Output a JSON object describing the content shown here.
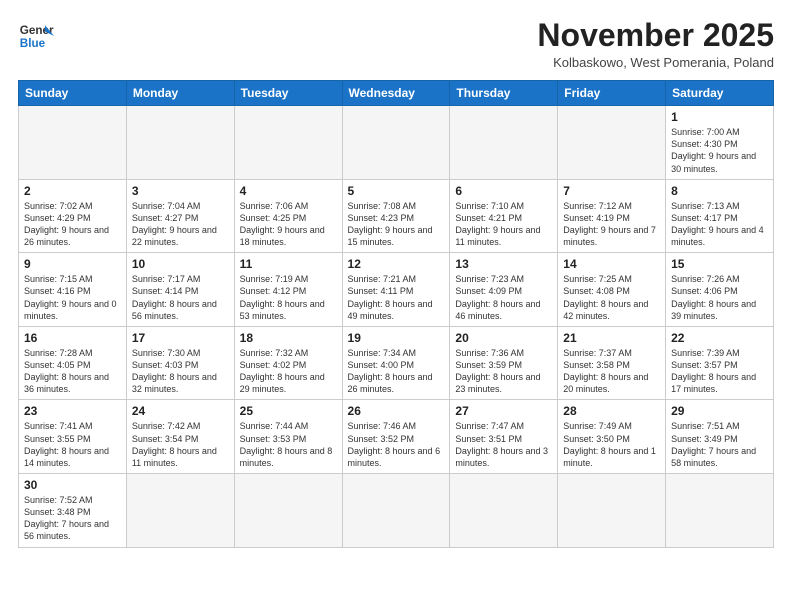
{
  "header": {
    "logo_general": "General",
    "logo_blue": "Blue",
    "month_title": "November 2025",
    "subtitle": "Kolbaskowo, West Pomerania, Poland"
  },
  "days_of_week": [
    "Sunday",
    "Monday",
    "Tuesday",
    "Wednesday",
    "Thursday",
    "Friday",
    "Saturday"
  ],
  "weeks": [
    [
      {
        "num": "",
        "info": ""
      },
      {
        "num": "",
        "info": ""
      },
      {
        "num": "",
        "info": ""
      },
      {
        "num": "",
        "info": ""
      },
      {
        "num": "",
        "info": ""
      },
      {
        "num": "",
        "info": ""
      },
      {
        "num": "1",
        "info": "Sunrise: 7:00 AM\nSunset: 4:30 PM\nDaylight: 9 hours and 30 minutes."
      }
    ],
    [
      {
        "num": "2",
        "info": "Sunrise: 7:02 AM\nSunset: 4:29 PM\nDaylight: 9 hours and 26 minutes."
      },
      {
        "num": "3",
        "info": "Sunrise: 7:04 AM\nSunset: 4:27 PM\nDaylight: 9 hours and 22 minutes."
      },
      {
        "num": "4",
        "info": "Sunrise: 7:06 AM\nSunset: 4:25 PM\nDaylight: 9 hours and 18 minutes."
      },
      {
        "num": "5",
        "info": "Sunrise: 7:08 AM\nSunset: 4:23 PM\nDaylight: 9 hours and 15 minutes."
      },
      {
        "num": "6",
        "info": "Sunrise: 7:10 AM\nSunset: 4:21 PM\nDaylight: 9 hours and 11 minutes."
      },
      {
        "num": "7",
        "info": "Sunrise: 7:12 AM\nSunset: 4:19 PM\nDaylight: 9 hours and 7 minutes."
      },
      {
        "num": "8",
        "info": "Sunrise: 7:13 AM\nSunset: 4:17 PM\nDaylight: 9 hours and 4 minutes."
      }
    ],
    [
      {
        "num": "9",
        "info": "Sunrise: 7:15 AM\nSunset: 4:16 PM\nDaylight: 9 hours and 0 minutes."
      },
      {
        "num": "10",
        "info": "Sunrise: 7:17 AM\nSunset: 4:14 PM\nDaylight: 8 hours and 56 minutes."
      },
      {
        "num": "11",
        "info": "Sunrise: 7:19 AM\nSunset: 4:12 PM\nDaylight: 8 hours and 53 minutes."
      },
      {
        "num": "12",
        "info": "Sunrise: 7:21 AM\nSunset: 4:11 PM\nDaylight: 8 hours and 49 minutes."
      },
      {
        "num": "13",
        "info": "Sunrise: 7:23 AM\nSunset: 4:09 PM\nDaylight: 8 hours and 46 minutes."
      },
      {
        "num": "14",
        "info": "Sunrise: 7:25 AM\nSunset: 4:08 PM\nDaylight: 8 hours and 42 minutes."
      },
      {
        "num": "15",
        "info": "Sunrise: 7:26 AM\nSunset: 4:06 PM\nDaylight: 8 hours and 39 minutes."
      }
    ],
    [
      {
        "num": "16",
        "info": "Sunrise: 7:28 AM\nSunset: 4:05 PM\nDaylight: 8 hours and 36 minutes."
      },
      {
        "num": "17",
        "info": "Sunrise: 7:30 AM\nSunset: 4:03 PM\nDaylight: 8 hours and 32 minutes."
      },
      {
        "num": "18",
        "info": "Sunrise: 7:32 AM\nSunset: 4:02 PM\nDaylight: 8 hours and 29 minutes."
      },
      {
        "num": "19",
        "info": "Sunrise: 7:34 AM\nSunset: 4:00 PM\nDaylight: 8 hours and 26 minutes."
      },
      {
        "num": "20",
        "info": "Sunrise: 7:36 AM\nSunset: 3:59 PM\nDaylight: 8 hours and 23 minutes."
      },
      {
        "num": "21",
        "info": "Sunrise: 7:37 AM\nSunset: 3:58 PM\nDaylight: 8 hours and 20 minutes."
      },
      {
        "num": "22",
        "info": "Sunrise: 7:39 AM\nSunset: 3:57 PM\nDaylight: 8 hours and 17 minutes."
      }
    ],
    [
      {
        "num": "23",
        "info": "Sunrise: 7:41 AM\nSunset: 3:55 PM\nDaylight: 8 hours and 14 minutes."
      },
      {
        "num": "24",
        "info": "Sunrise: 7:42 AM\nSunset: 3:54 PM\nDaylight: 8 hours and 11 minutes."
      },
      {
        "num": "25",
        "info": "Sunrise: 7:44 AM\nSunset: 3:53 PM\nDaylight: 8 hours and 8 minutes."
      },
      {
        "num": "26",
        "info": "Sunrise: 7:46 AM\nSunset: 3:52 PM\nDaylight: 8 hours and 6 minutes."
      },
      {
        "num": "27",
        "info": "Sunrise: 7:47 AM\nSunset: 3:51 PM\nDaylight: 8 hours and 3 minutes."
      },
      {
        "num": "28",
        "info": "Sunrise: 7:49 AM\nSunset: 3:50 PM\nDaylight: 8 hours and 1 minute."
      },
      {
        "num": "29",
        "info": "Sunrise: 7:51 AM\nSunset: 3:49 PM\nDaylight: 7 hours and 58 minutes."
      }
    ],
    [
      {
        "num": "30",
        "info": "Sunrise: 7:52 AM\nSunset: 3:48 PM\nDaylight: 7 hours and 56 minutes."
      },
      {
        "num": "",
        "info": ""
      },
      {
        "num": "",
        "info": ""
      },
      {
        "num": "",
        "info": ""
      },
      {
        "num": "",
        "info": ""
      },
      {
        "num": "",
        "info": ""
      },
      {
        "num": "",
        "info": ""
      }
    ]
  ]
}
